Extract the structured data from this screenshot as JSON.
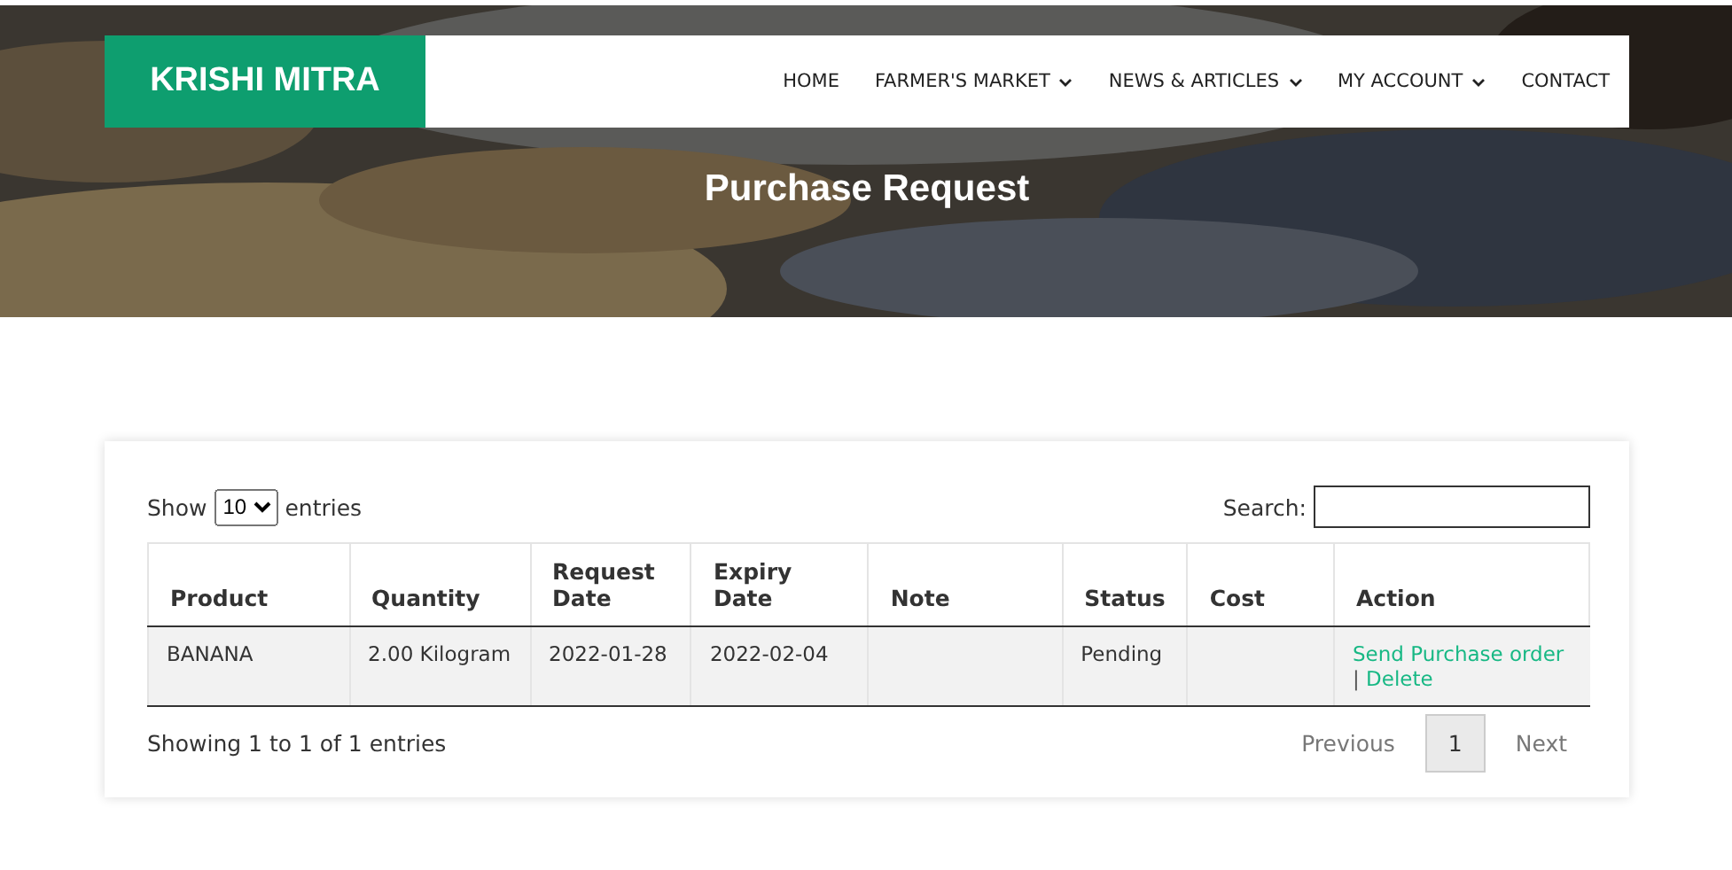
{
  "brand": "KRISHI MITRA",
  "nav": [
    {
      "label": "HOME",
      "dropdown": false
    },
    {
      "label": "FARMER'S MARKET",
      "dropdown": true
    },
    {
      "label": "NEWS & ARTICLES",
      "dropdown": true
    },
    {
      "label": "MY ACCOUNT",
      "dropdown": true
    },
    {
      "label": "CONTACT",
      "dropdown": false
    }
  ],
  "page_title": "Purchase Request",
  "length_menu": {
    "before": "Show",
    "value": "10",
    "after": "entries"
  },
  "search": {
    "label": "Search:"
  },
  "table": {
    "columns": [
      "Product",
      "Quantity",
      "Request Date",
      "Expiry Date",
      "Note",
      "Status",
      "Cost",
      "Action"
    ],
    "rows": [
      {
        "cells": [
          "BANANA",
          "2.00 Kilogram",
          "2022-01-28",
          "2022-02-04",
          "",
          "Pending",
          ""
        ],
        "actions": [
          "Send Purchase order",
          "Delete"
        ],
        "separator": "|"
      }
    ]
  },
  "info": "Showing 1 to 1 of 1 entries",
  "pagination": [
    {
      "label": "Previous",
      "selected": false
    },
    {
      "label": "1",
      "selected": true
    },
    {
      "label": "Next",
      "selected": false
    }
  ]
}
